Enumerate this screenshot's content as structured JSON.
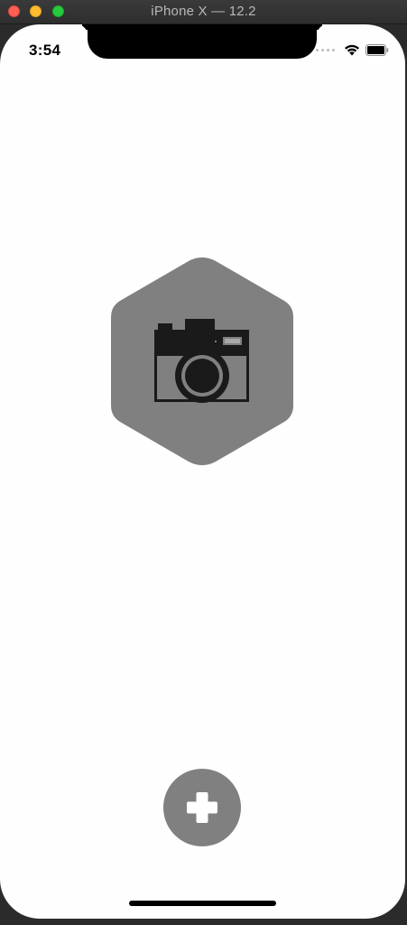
{
  "window": {
    "title": "iPhone X — 12.2",
    "controls": [
      "close",
      "minimize",
      "maximize"
    ]
  },
  "status_bar": {
    "time": "3:54",
    "icons": [
      "signal-dots-icon",
      "wifi-icon",
      "battery-icon"
    ]
  },
  "main": {
    "photo_placeholder": {
      "shape": "hexagon",
      "icon": "camera-icon",
      "fill": "#808080",
      "icon_color": "#1a1a1a"
    }
  },
  "fab": {
    "icon": "plus-icon",
    "fill": "#808080",
    "icon_color": "#ffffff"
  },
  "colors": {
    "screen_bg": "#fefefe",
    "titlebar_text": "#b8b8b8"
  }
}
